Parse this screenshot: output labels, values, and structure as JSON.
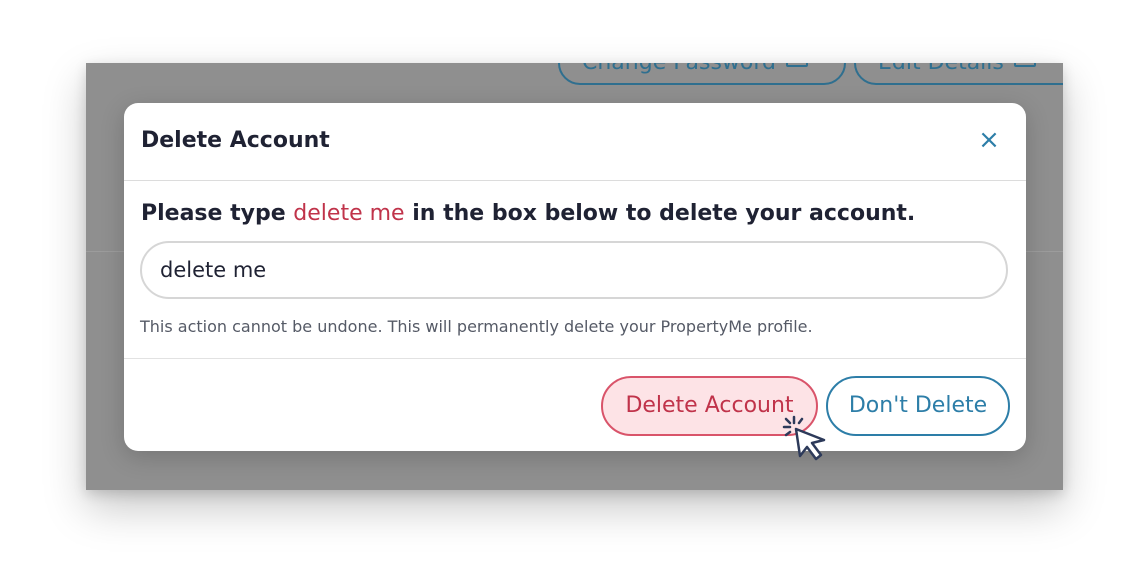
{
  "background": {
    "buttons": [
      "Change Password",
      "Edit Details"
    ]
  },
  "modal": {
    "title": "Delete Account",
    "close_label": "×",
    "instruction": {
      "prefix": "Please type ",
      "highlight": "delete me",
      "suffix": " in the box below to delete your account."
    },
    "input_value": "delete me",
    "warning": "This action cannot be undone. This will permanently delete your PropertyMe profile.",
    "delete_label": "Delete Account",
    "cancel_label": "Don't Delete"
  },
  "colors": {
    "danger": "#c0334a",
    "primary": "#2d7ea8",
    "overlay": "#8f8f8f"
  },
  "icons": [
    "close-icon",
    "pointer-cursor-icon",
    "edit-icon"
  ]
}
